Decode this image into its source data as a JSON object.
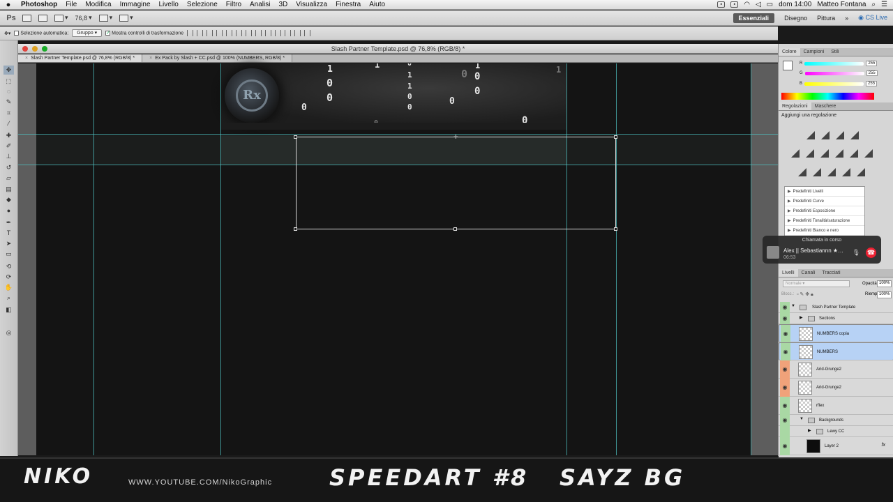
{
  "menubar": {
    "apple": "",
    "items": [
      "Photoshop",
      "File",
      "Modifica",
      "Immagine",
      "Livello",
      "Selezione",
      "Filtro",
      "Analisi",
      "3D",
      "Visualizza",
      "Finestra",
      "Aiuto"
    ],
    "clock": "dom 14:00",
    "user": "Matteo Fontana"
  },
  "appbar": {
    "logo": "Ps",
    "zoom": "76,8",
    "workspace_active": "Essenziali",
    "workspace_2": "Disegno",
    "workspace_3": "Pittura",
    "more": "»",
    "cslive": "CS Live"
  },
  "options": {
    "auto_select_label": "Selezione automatica:",
    "auto_select_value": "Gruppo",
    "show_transform_label": "Mostra controlli di trasformazione"
  },
  "document": {
    "window_title": "Slash Partner Template.psd @ 76,8% (RGB/8) *",
    "tab1": "Slash Partner Template.psd @ 76,8% (RGB/8) *",
    "tab2": "Ex Pack by Slash + CC.psd @ 100% (NUMBERS, RGB/8) *",
    "emblem_text": "Rx"
  },
  "digits": [
    {
      "t": "1"
    },
    {
      "t": "0"
    },
    {
      "t": "0"
    },
    {
      "t": "0"
    },
    {
      "t": "1"
    },
    {
      "t": "0"
    },
    {
      "t": "1"
    },
    {
      "t": "1"
    },
    {
      "t": "0"
    },
    {
      "t": "0"
    },
    {
      "t": "0"
    },
    {
      "t": "0"
    },
    {
      "t": "1"
    },
    {
      "t": "0"
    },
    {
      "t": "0"
    },
    {
      "t": "1"
    },
    {
      "t": "0"
    },
    {
      "t": "0"
    }
  ],
  "color_panel": {
    "tabs": [
      "Colore",
      "Campioni",
      "Stili"
    ],
    "r_label": "R",
    "g_label": "G",
    "b_label": "B",
    "r": "255",
    "g": "255",
    "b": "255"
  },
  "adjust_panel": {
    "tabs": [
      "Regolazioni",
      "Maschere"
    ],
    "heading": "Aggiungi una regolazione",
    "presets": [
      "Predefiniti Livelli",
      "Predefiniti Curve",
      "Predefiniti Esposizione",
      "Predefiniti Tonalità/saturazione",
      "Predefiniti Bianco e nero"
    ]
  },
  "call": {
    "title": "Chiamata in corso",
    "name": "Alex || Sebastiannn ★…",
    "time": "06:53"
  },
  "layers_panel": {
    "tabs": [
      "Livelli",
      "Canali",
      "Tracciati"
    ],
    "blend": "Normale",
    "opacity_label": "Opacità:",
    "opacity": "100%",
    "lock_label": "Blocc.:",
    "fill_label": "Riemp.:",
    "fill": "100%",
    "rows": {
      "group_main": "Slash Partner Template",
      "sections": "Sections",
      "numbers_copy": "NUMBERS copia",
      "numbers": "NUMBERS",
      "arid1": "Arid-Grunge2",
      "arid2": "Arid-Grunge2",
      "rflex": "rflex",
      "backgrounds": "Backgrounds",
      "lewy": "Lewy CC",
      "layer2": "Layer 2",
      "fx": "fx"
    }
  },
  "watermark": {
    "left": "NIKO",
    "url": "WWW.YOUTUBE.COM/NikoGraphic",
    "title": "SPEEDART #8",
    "right": "SAYZ BG"
  },
  "colors": {
    "guide": "#4fc3c3",
    "selected_layer": "#b7d2f5",
    "call_end": "#ee2233"
  }
}
